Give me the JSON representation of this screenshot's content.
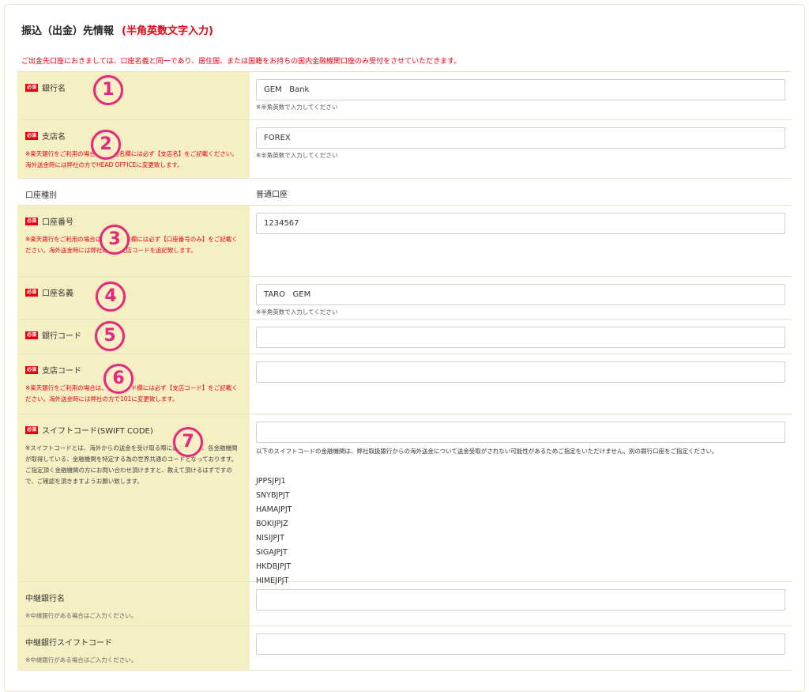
{
  "heading": {
    "title": "振込（出金）先情報",
    "accent": "(半角英数文字入力)"
  },
  "notice": "ご出金先口座におきましては、口座名義と同一であり、居住国、または国籍をお持ちの国内金融機関口座のみ受付をさせていただきます。",
  "required_badge": "必須",
  "half_width_hint": "※半角英数で入力してください",
  "fields": {
    "bank_name": {
      "label": "銀行名",
      "value": "GEM   Bank",
      "marker": "1"
    },
    "branch_name": {
      "label": "支店名",
      "value": "FOREX",
      "note": "※楽天銀行をご利用の場合は、支店名欄には必ず【支店名】をご記載ください。海外送金時には弊社の方でHEAD OFFICEに変更致します。",
      "marker": "2"
    },
    "account_type": {
      "label": "口座種別",
      "value": "普通口座"
    },
    "account_number": {
      "label": "口座番号",
      "value": "1234567",
      "note": "※楽天銀行をご利用の場合は、口座番号欄には必ず【口座番号のみ】をご記載ください。海外送金時には弊社の方で支店コードを追記致します。",
      "marker": "3"
    },
    "account_holder": {
      "label": "口座名義",
      "value": "TARO   GEM",
      "marker": "4"
    },
    "bank_code": {
      "label": "銀行コード",
      "value": "",
      "marker": "5"
    },
    "branch_code": {
      "label": "支店コード",
      "value": "",
      "note": "※楽天銀行をご利用の場合は、支店コード欄には必ず【支店コード】をご記載ください。海外送金時には弊社の方で101に変更致します。",
      "marker": "6"
    },
    "swift_code": {
      "label": "スイフトコード(SWIFT CODE)",
      "value": "",
      "note": "※スイフトコードとは、海外からの送金を受け取る際に必要となる、各金融機関が取得している、金融機関を特定する為の世界共通のコードとなっております。ご指定頂く金融機関の方にお問い合わせ頂けますと、教えて頂けるはずですので、ご確認を頂きますようお願い致します。",
      "warning": "以下のスイフトコードの金融機関は、弊社取扱銀行からの海外送金について送金受取がされない可能性があるためご指定をいただけません。別の銀行口座をご指定ください。",
      "blocked_codes": [
        "JPPSJPJ1",
        "SNYBJPJT",
        "HAMAJPJT",
        "BOKIJPJZ",
        "NISIJPJT",
        "SIGAJPJT",
        "HKDBJPJT",
        "HIMEJPJT"
      ],
      "marker": "7"
    },
    "intermediary_bank": {
      "label": "中継銀行名",
      "value": "",
      "note": "※中継銀行がある場合はご入力ください。"
    },
    "intermediary_swift": {
      "label": "中継銀行スイフトコード",
      "value": "",
      "note": "※中継銀行がある場合はご入力ください。"
    }
  },
  "colors": {
    "accent_red": "#e60012",
    "label_bg": "#f5f0c3",
    "marker_pink": "#e4287c"
  }
}
